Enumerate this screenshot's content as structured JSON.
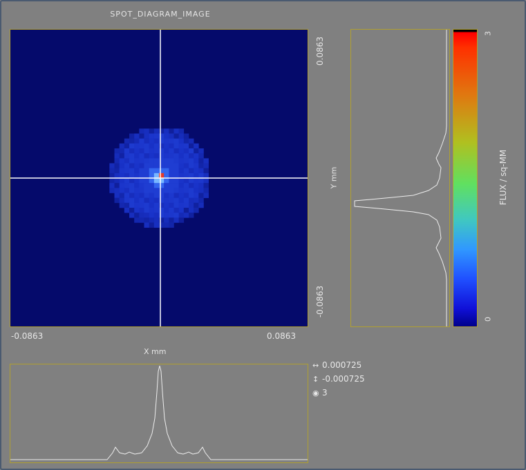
{
  "window": {
    "title": "SPOT_DIAGRAM_IMAGE"
  },
  "image_axes": {
    "x_min": "-0.0863",
    "x_max": "0.0863",
    "x_label": "X mm",
    "y_max": "0.0863",
    "y_min": "-0.0863",
    "y_label": "Y mm"
  },
  "colorbar": {
    "max_label": "3",
    "min_label": "0",
    "label": "FLUX / sq-MM",
    "stops": [
      "#000000",
      "#ff0000",
      "#e07810",
      "#b0c020",
      "#60e060",
      "#40c8c0",
      "#3098ff",
      "#1010d8",
      "#00008a"
    ]
  },
  "stats": [
    {
      "icon": "horizontal-arrow-icon",
      "value": "0.000725"
    },
    {
      "icon": "vertical-arrow-icon",
      "value": "-0.000725"
    },
    {
      "icon": "peak-icon",
      "value": "3"
    }
  ],
  "colors": {
    "background": "#808080",
    "image_bg": "#050a6b",
    "border": "#b0a030",
    "crosshair": "#ffffff"
  }
}
